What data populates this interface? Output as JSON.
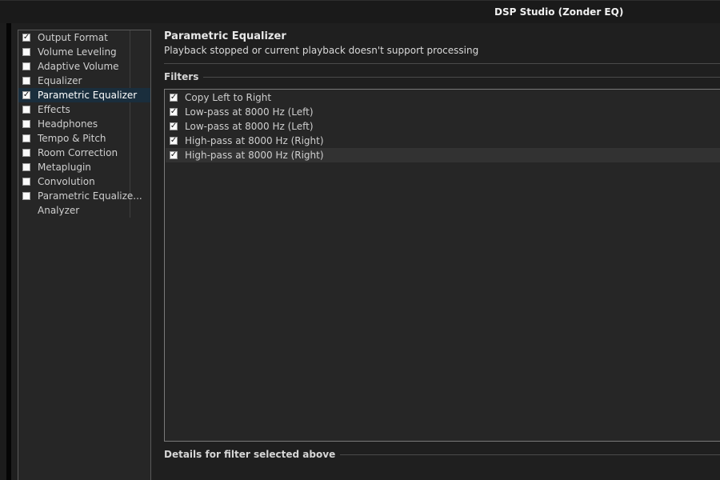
{
  "window": {
    "title": "DSP Studio (Zonder EQ)"
  },
  "sidebar": {
    "items": [
      {
        "label": "Output Format",
        "checked": true,
        "has_checkbox": true
      },
      {
        "label": "Volume Leveling",
        "checked": false,
        "has_checkbox": true
      },
      {
        "label": "Adaptive Volume",
        "checked": false,
        "has_checkbox": true
      },
      {
        "label": "Equalizer",
        "checked": false,
        "has_checkbox": true
      },
      {
        "label": "Parametric Equalizer",
        "checked": true,
        "has_checkbox": true,
        "selected": true
      },
      {
        "label": "Effects",
        "checked": false,
        "has_checkbox": true
      },
      {
        "label": "Headphones",
        "checked": false,
        "has_checkbox": true
      },
      {
        "label": "Tempo & Pitch",
        "checked": false,
        "has_checkbox": true
      },
      {
        "label": "Room Correction",
        "checked": false,
        "has_checkbox": true
      },
      {
        "label": "Metaplugin",
        "checked": false,
        "has_checkbox": true
      },
      {
        "label": "Convolution",
        "checked": false,
        "has_checkbox": true
      },
      {
        "label": "Parametric Equalize...",
        "checked": false,
        "has_checkbox": true
      },
      {
        "label": "Analyzer",
        "checked": false,
        "has_checkbox": false
      }
    ]
  },
  "main": {
    "title": "Parametric Equalizer",
    "status": "Playback stopped or current playback doesn't support processing",
    "filters_section_label": "Filters",
    "filters": [
      {
        "label": "Copy Left to Right",
        "checked": true
      },
      {
        "label": "Low-pass at 8000 Hz (Left)",
        "checked": true
      },
      {
        "label": "Low-pass at 8000 Hz (Left)",
        "checked": true
      },
      {
        "label": "High-pass at 8000 Hz (Right)",
        "checked": true
      },
      {
        "label": "High-pass at 8000 Hz (Right)",
        "checked": true,
        "selected": true
      }
    ],
    "details_section_label": "Details for filter selected above"
  },
  "colors": {
    "background": "#1f1f1f",
    "panel": "#262626",
    "selection": "#1a2e3d"
  }
}
